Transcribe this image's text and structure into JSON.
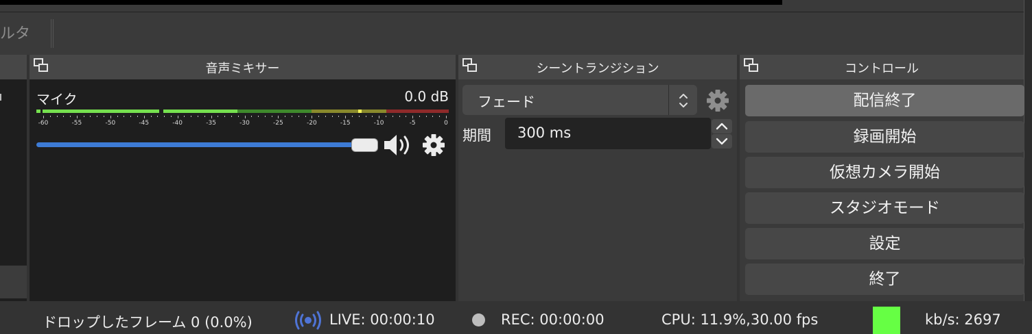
{
  "filter_toolbar": {
    "label": "ルタ"
  },
  "docks": {
    "audio_mixer": {
      "title": "音声ミキサー"
    },
    "scene_transitions": {
      "title": "シーントランジション"
    },
    "controls": {
      "title": "コントロール"
    }
  },
  "mixer": {
    "channel_name": "マイク",
    "level": "0.0 dB",
    "ticks": [
      "-60",
      "-55",
      "-50",
      "-45",
      "-40",
      "-35",
      "-30",
      "-25",
      "-20",
      "-15",
      "-10",
      "-5",
      "0"
    ],
    "volume_fraction": 1.0
  },
  "transition": {
    "selected": "フェード",
    "duration_label": "期間",
    "duration_value": "300 ms"
  },
  "controls": [
    "配信終了",
    "録画開始",
    "仮想カメラ開始",
    "スタジオモード",
    "設定",
    "終了"
  ],
  "status": {
    "dropped_frames": "ドロップしたフレーム 0 (0.0%)",
    "live": "LIVE: 00:00:10",
    "rec": "REC: 00:00:00",
    "cpu": "CPU: 11.9%,30.00 fps",
    "kbps": "kb/s: 2697"
  },
  "colors": {
    "volume_bar": "#3d7bd5",
    "bitrate_indicator": "#66ff44",
    "live_icon": "#4f74d6"
  }
}
